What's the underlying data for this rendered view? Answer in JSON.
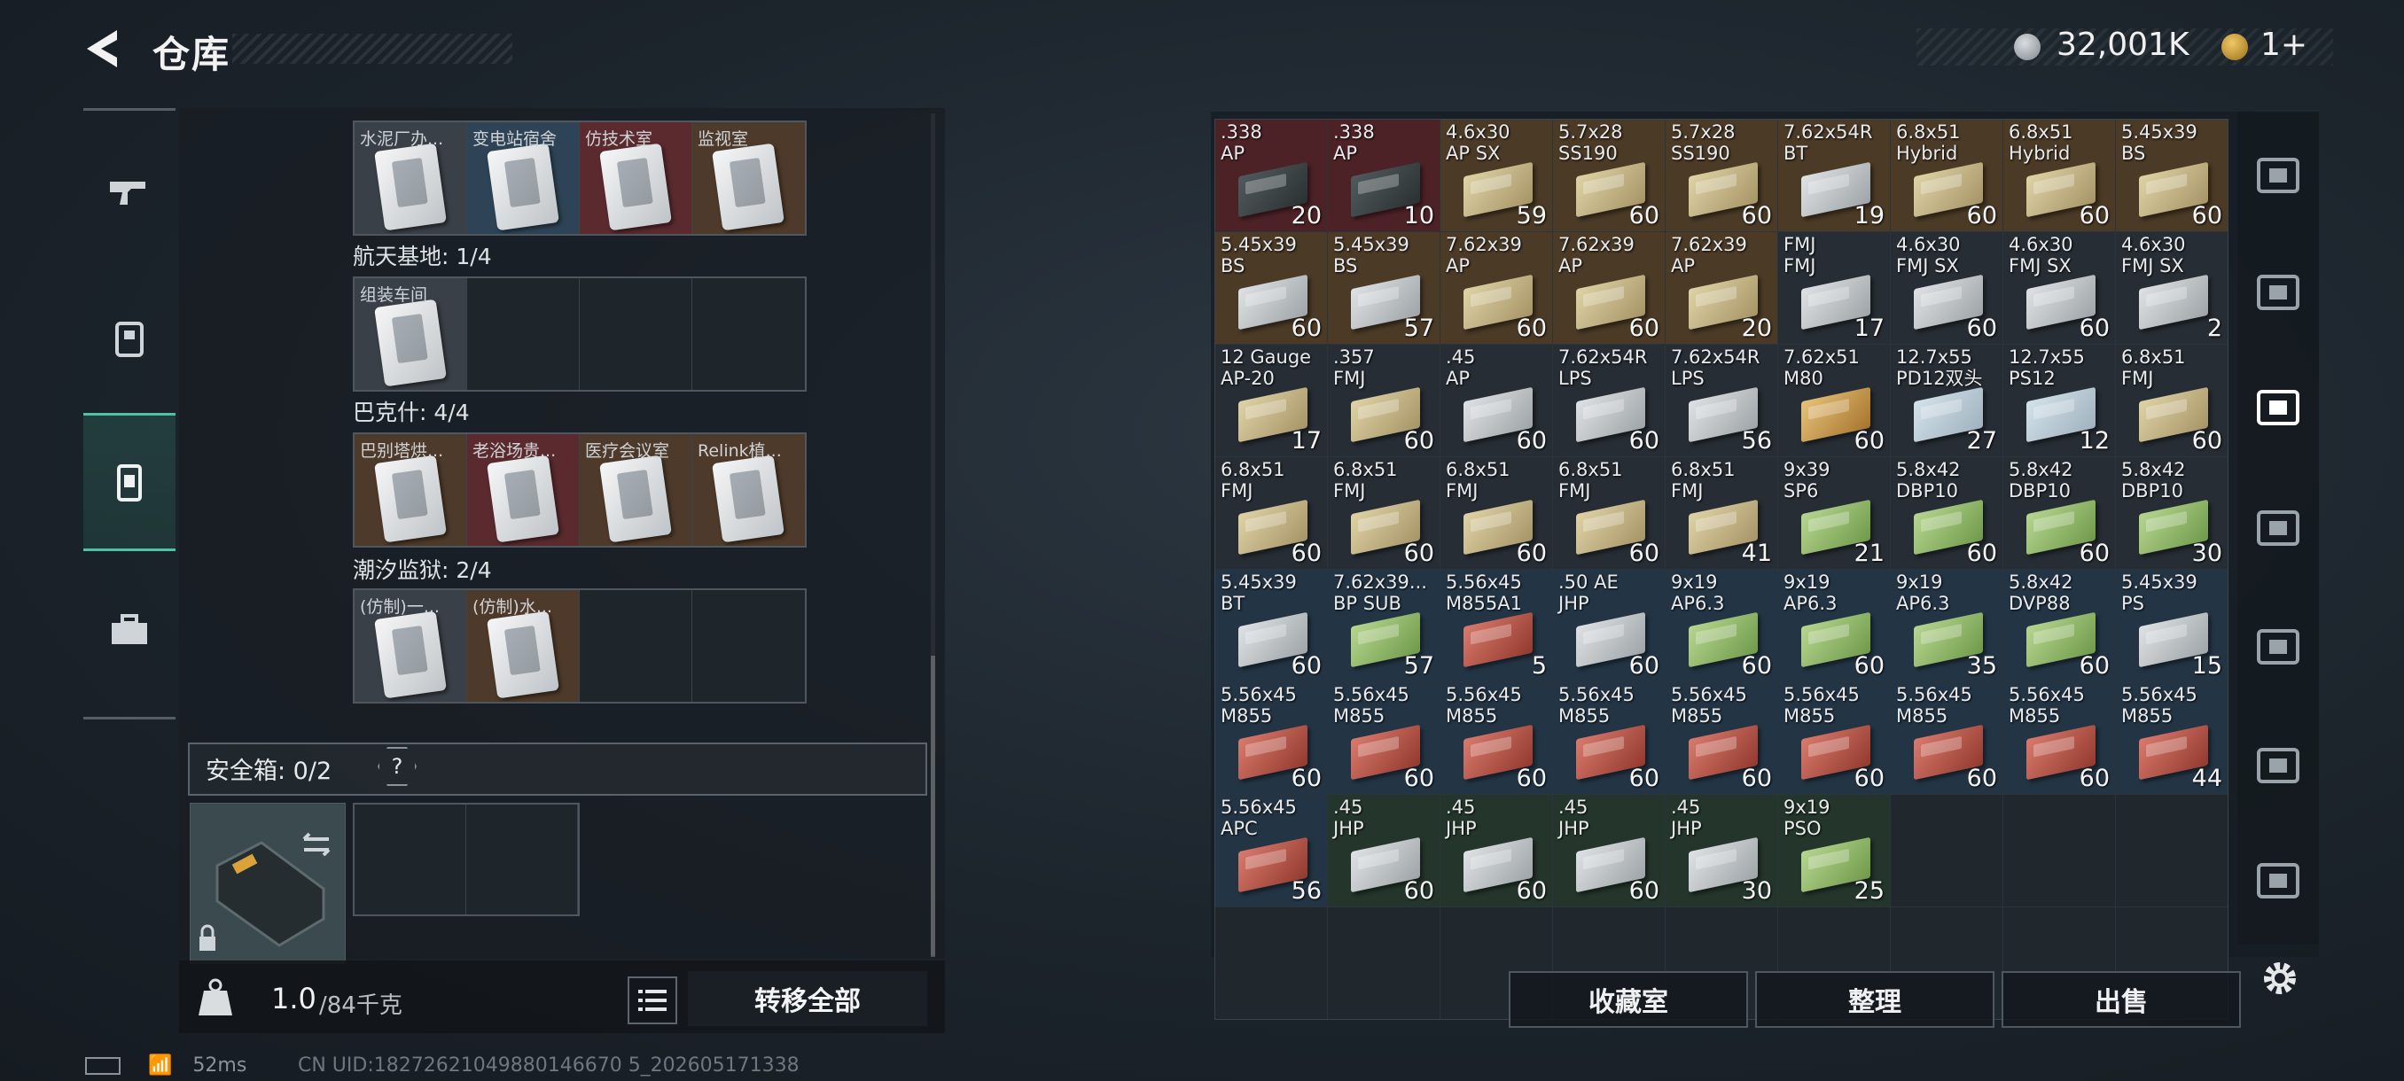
{
  "header": {
    "title": "仓库",
    "money": "32,001K",
    "premium": "1+"
  },
  "left": {
    "rail": [
      "weapon-icon",
      "backpack-icon",
      "container-icon",
      "toolbox-icon"
    ],
    "regions": [
      {
        "label": "",
        "rooms": [
          {
            "name": "水泥厂办...",
            "bg": "gray"
          },
          {
            "name": "变电站宿舍",
            "bg": "blue"
          },
          {
            "name": "仿技术室",
            "bg": "red"
          },
          {
            "name": "监视室",
            "bg": "brown"
          }
        ]
      },
      {
        "label": "航天基地: 1/4",
        "rooms": [
          {
            "name": "组装车间",
            "bg": "gray"
          },
          {
            "name": "",
            "bg": "empty"
          },
          {
            "name": "",
            "bg": "empty"
          },
          {
            "name": "",
            "bg": "empty"
          }
        ]
      },
      {
        "label": "巴克什: 4/4",
        "rooms": [
          {
            "name": "巴别塔烘...",
            "bg": "brown"
          },
          {
            "name": "老浴场贵...",
            "bg": "red"
          },
          {
            "name": "医疗会议室",
            "bg": "brown"
          },
          {
            "name": "Relink植...",
            "bg": "brown"
          }
        ]
      },
      {
        "label": "潮汐监狱: 2/4",
        "rooms": [
          {
            "name": "(仿制)一...",
            "bg": "gray"
          },
          {
            "name": "(仿制)水...",
            "bg": "brown"
          },
          {
            "name": "",
            "bg": "empty"
          },
          {
            "name": "",
            "bg": "empty"
          }
        ]
      }
    ],
    "safebox_label": "安全箱: 0/2",
    "help": "?",
    "weight_val": "1.0",
    "weight_max": "/84千克",
    "transfer_all": "转移全部"
  },
  "items": [
    {
      "name": ".338\nAP",
      "count": "20",
      "bg": "red",
      "box": "dark"
    },
    {
      "name": ".338\nAP",
      "count": "10",
      "bg": "red",
      "box": "dark"
    },
    {
      "name": "4.6x30\nAP SX",
      "count": "59",
      "bg": "gold",
      "box": "tan"
    },
    {
      "name": "5.7x28\nSS190",
      "count": "60",
      "bg": "gold",
      "box": "tan"
    },
    {
      "name": "5.7x28\nSS190",
      "count": "60",
      "bg": "gold",
      "box": "tan"
    },
    {
      "name": "7.62x54R\nBT",
      "count": "19",
      "bg": "gold",
      "box": "gray"
    },
    {
      "name": "6.8x51\nHybrid",
      "count": "60",
      "bg": "gold",
      "box": "tan"
    },
    {
      "name": "6.8x51\nHybrid",
      "count": "60",
      "bg": "gold",
      "box": "tan"
    },
    {
      "name": "5.45x39\nBS",
      "count": "60",
      "bg": "gold",
      "box": "tan"
    },
    {
      "name": "5.45x39\nBS",
      "count": "60",
      "bg": "gold",
      "box": "gray"
    },
    {
      "name": "5.45x39\nBS",
      "count": "57",
      "bg": "gold",
      "box": "gray"
    },
    {
      "name": "7.62x39\nAP",
      "count": "60",
      "bg": "gold",
      "box": "tan"
    },
    {
      "name": "7.62x39\nAP",
      "count": "60",
      "bg": "gold",
      "box": "tan"
    },
    {
      "name": "7.62x39\nAP",
      "count": "20",
      "bg": "gold",
      "box": "tan"
    },
    {
      "name": "FMJ\nFMJ",
      "count": "17",
      "bg": "dark",
      "box": "gray"
    },
    {
      "name": "4.6x30\nFMJ SX",
      "count": "60",
      "bg": "dark",
      "box": "gray"
    },
    {
      "name": "4.6x30\nFMJ SX",
      "count": "60",
      "bg": "dark",
      "box": "gray"
    },
    {
      "name": "4.6x30\nFMJ SX",
      "count": "2",
      "bg": "dark",
      "box": "gray"
    },
    {
      "name": "12 Gauge\nAP-20",
      "count": "17",
      "bg": "dark",
      "box": "tan"
    },
    {
      "name": ".357\nFMJ",
      "count": "60",
      "bg": "dark",
      "box": "tan"
    },
    {
      "name": ".45\nAP",
      "count": "60",
      "bg": "dark",
      "box": "gray"
    },
    {
      "name": "7.62x54R\nLPS",
      "count": "60",
      "bg": "dark",
      "box": "gray"
    },
    {
      "name": "7.62x54R\nLPS",
      "count": "56",
      "bg": "dark",
      "box": "gray"
    },
    {
      "name": "7.62x51\nM80",
      "count": "60",
      "bg": "dark",
      "box": "orange"
    },
    {
      "name": "12.7x55\nPD12双头",
      "count": "27",
      "bg": "dark",
      "box": "blue"
    },
    {
      "name": "12.7x55\nPS12",
      "count": "12",
      "bg": "dark",
      "box": "blue"
    },
    {
      "name": "6.8x51\nFMJ",
      "count": "60",
      "bg": "dark",
      "box": "tan"
    },
    {
      "name": "6.8x51\nFMJ",
      "count": "60",
      "bg": "dark",
      "box": "tan"
    },
    {
      "name": "6.8x51\nFMJ",
      "count": "60",
      "bg": "dark",
      "box": "tan"
    },
    {
      "name": "6.8x51\nFMJ",
      "count": "60",
      "bg": "dark",
      "box": "tan"
    },
    {
      "name": "6.8x51\nFMJ",
      "count": "60",
      "bg": "dark",
      "box": "tan"
    },
    {
      "name": "6.8x51\nFMJ",
      "count": "41",
      "bg": "dark",
      "box": "tan"
    },
    {
      "name": "9x39\nSP6",
      "count": "21",
      "bg": "dark",
      "box": "green"
    },
    {
      "name": "5.8x42\nDBP10",
      "count": "60",
      "bg": "dark",
      "box": "green"
    },
    {
      "name": "5.8x42\nDBP10",
      "count": "60",
      "bg": "dark",
      "box": "green"
    },
    {
      "name": "5.8x42\nDBP10",
      "count": "30",
      "bg": "dark",
      "box": "green"
    },
    {
      "name": "5.45x39\nBT",
      "count": "60",
      "bg": "blue",
      "box": "gray"
    },
    {
      "name": "7.62x39...\nBP SUB",
      "count": "57",
      "bg": "blue",
      "box": "green"
    },
    {
      "name": "5.56x45\nM855A1",
      "count": "5",
      "bg": "blue",
      "box": "red"
    },
    {
      "name": ".50 AE\nJHP",
      "count": "60",
      "bg": "blue",
      "box": "gray"
    },
    {
      "name": "9x19\nAP6.3",
      "count": "60",
      "bg": "blue",
      "box": "green"
    },
    {
      "name": "9x19\nAP6.3",
      "count": "60",
      "bg": "blue",
      "box": "green"
    },
    {
      "name": "9x19\nAP6.3",
      "count": "35",
      "bg": "blue",
      "box": "green"
    },
    {
      "name": "5.8x42\nDVP88",
      "count": "60",
      "bg": "blue",
      "box": "green"
    },
    {
      "name": "5.45x39\nPS",
      "count": "15",
      "bg": "blue",
      "box": "gray"
    },
    {
      "name": "5.56x45\nM855",
      "count": "60",
      "bg": "blue",
      "box": "red"
    },
    {
      "name": "5.56x45\nM855",
      "count": "60",
      "bg": "blue",
      "box": "red"
    },
    {
      "name": "5.56x45\nM855",
      "count": "60",
      "bg": "blue",
      "box": "red"
    },
    {
      "name": "5.56x45\nM855",
      "count": "60",
      "bg": "blue",
      "box": "red"
    },
    {
      "name": "5.56x45\nM855",
      "count": "60",
      "bg": "blue",
      "box": "red"
    },
    {
      "name": "5.56x45\nM855",
      "count": "60",
      "bg": "blue",
      "box": "red"
    },
    {
      "name": "5.56x45\nM855",
      "count": "60",
      "bg": "blue",
      "box": "red"
    },
    {
      "name": "5.56x45\nM855",
      "count": "60",
      "bg": "blue",
      "box": "red"
    },
    {
      "name": "5.56x45\nM855",
      "count": "44",
      "bg": "blue",
      "box": "red"
    },
    {
      "name": "5.56x45\nAPC",
      "count": "56",
      "bg": "blue",
      "box": "red"
    },
    {
      "name": ".45\nJHP",
      "count": "60",
      "bg": "green",
      "box": "gray"
    },
    {
      "name": ".45\nJHP",
      "count": "60",
      "bg": "green",
      "box": "gray"
    },
    {
      "name": ".45\nJHP",
      "count": "60",
      "bg": "green",
      "box": "gray"
    },
    {
      "name": ".45\nJHP",
      "count": "30",
      "bg": "green",
      "box": "gray"
    },
    {
      "name": "9x19\nPSO",
      "count": "25",
      "bg": "green",
      "box": "green"
    }
  ],
  "empty_cells": 12,
  "right_rail": [
    "helmet-icon",
    "tier-iv-case-icon",
    "tier-iv-folder-icon",
    "tier-iii-case-icon",
    "tier-iii-warning-icon",
    "tier-iii-rack-icon",
    "tier-v-case-icon"
  ],
  "buttons": {
    "collection": "收藏室",
    "sort": "整理",
    "sell": "出售"
  },
  "status": {
    "ping": "52ms",
    "uid": "CN UID:18272621049880146670 5_202605171338"
  }
}
